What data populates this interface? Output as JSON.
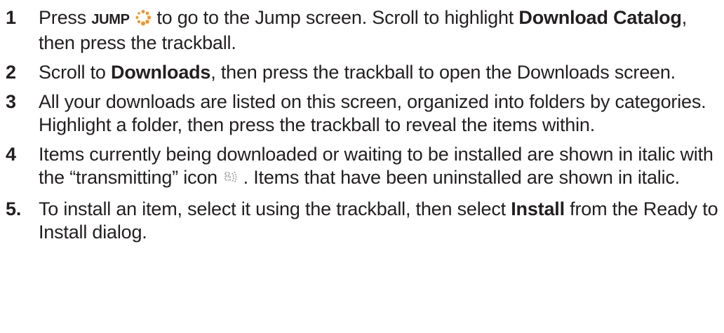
{
  "steps": [
    {
      "number": "1",
      "text_a": "Press ",
      "jump_label": "JUMP",
      "jump_icon": "jump-dots-icon",
      "text_b": " to go to the Jump screen. Scroll to highlight ",
      "bold_a": "Download Catalog",
      "text_c": ", then press the trackball."
    },
    {
      "number": "2",
      "text_a": "Scroll to ",
      "bold_a": "Downloads",
      "text_b": ", then press the trackball to open the Downloads screen."
    },
    {
      "number": "3",
      "text_a": "All your downloads are listed on this screen, organized into folders by categories. Highlight a folder, then press the trackball to reveal the items within."
    },
    {
      "number": "4",
      "text_a": "Items currently being downloaded or waiting to be installed are shown in italic with the “transmitting” icon ",
      "icon": "transmitting-icon",
      "text_b": " . Items that have been uninstalled are shown in italic."
    },
    {
      "number": "5.",
      "text_a": "To install an item, select it using the trackball, then select ",
      "bold_a": "Install",
      "text_b": " from the Ready to Install dialog."
    }
  ],
  "colors": {
    "text": "#231f20",
    "jump_icon": "#f7941d"
  }
}
